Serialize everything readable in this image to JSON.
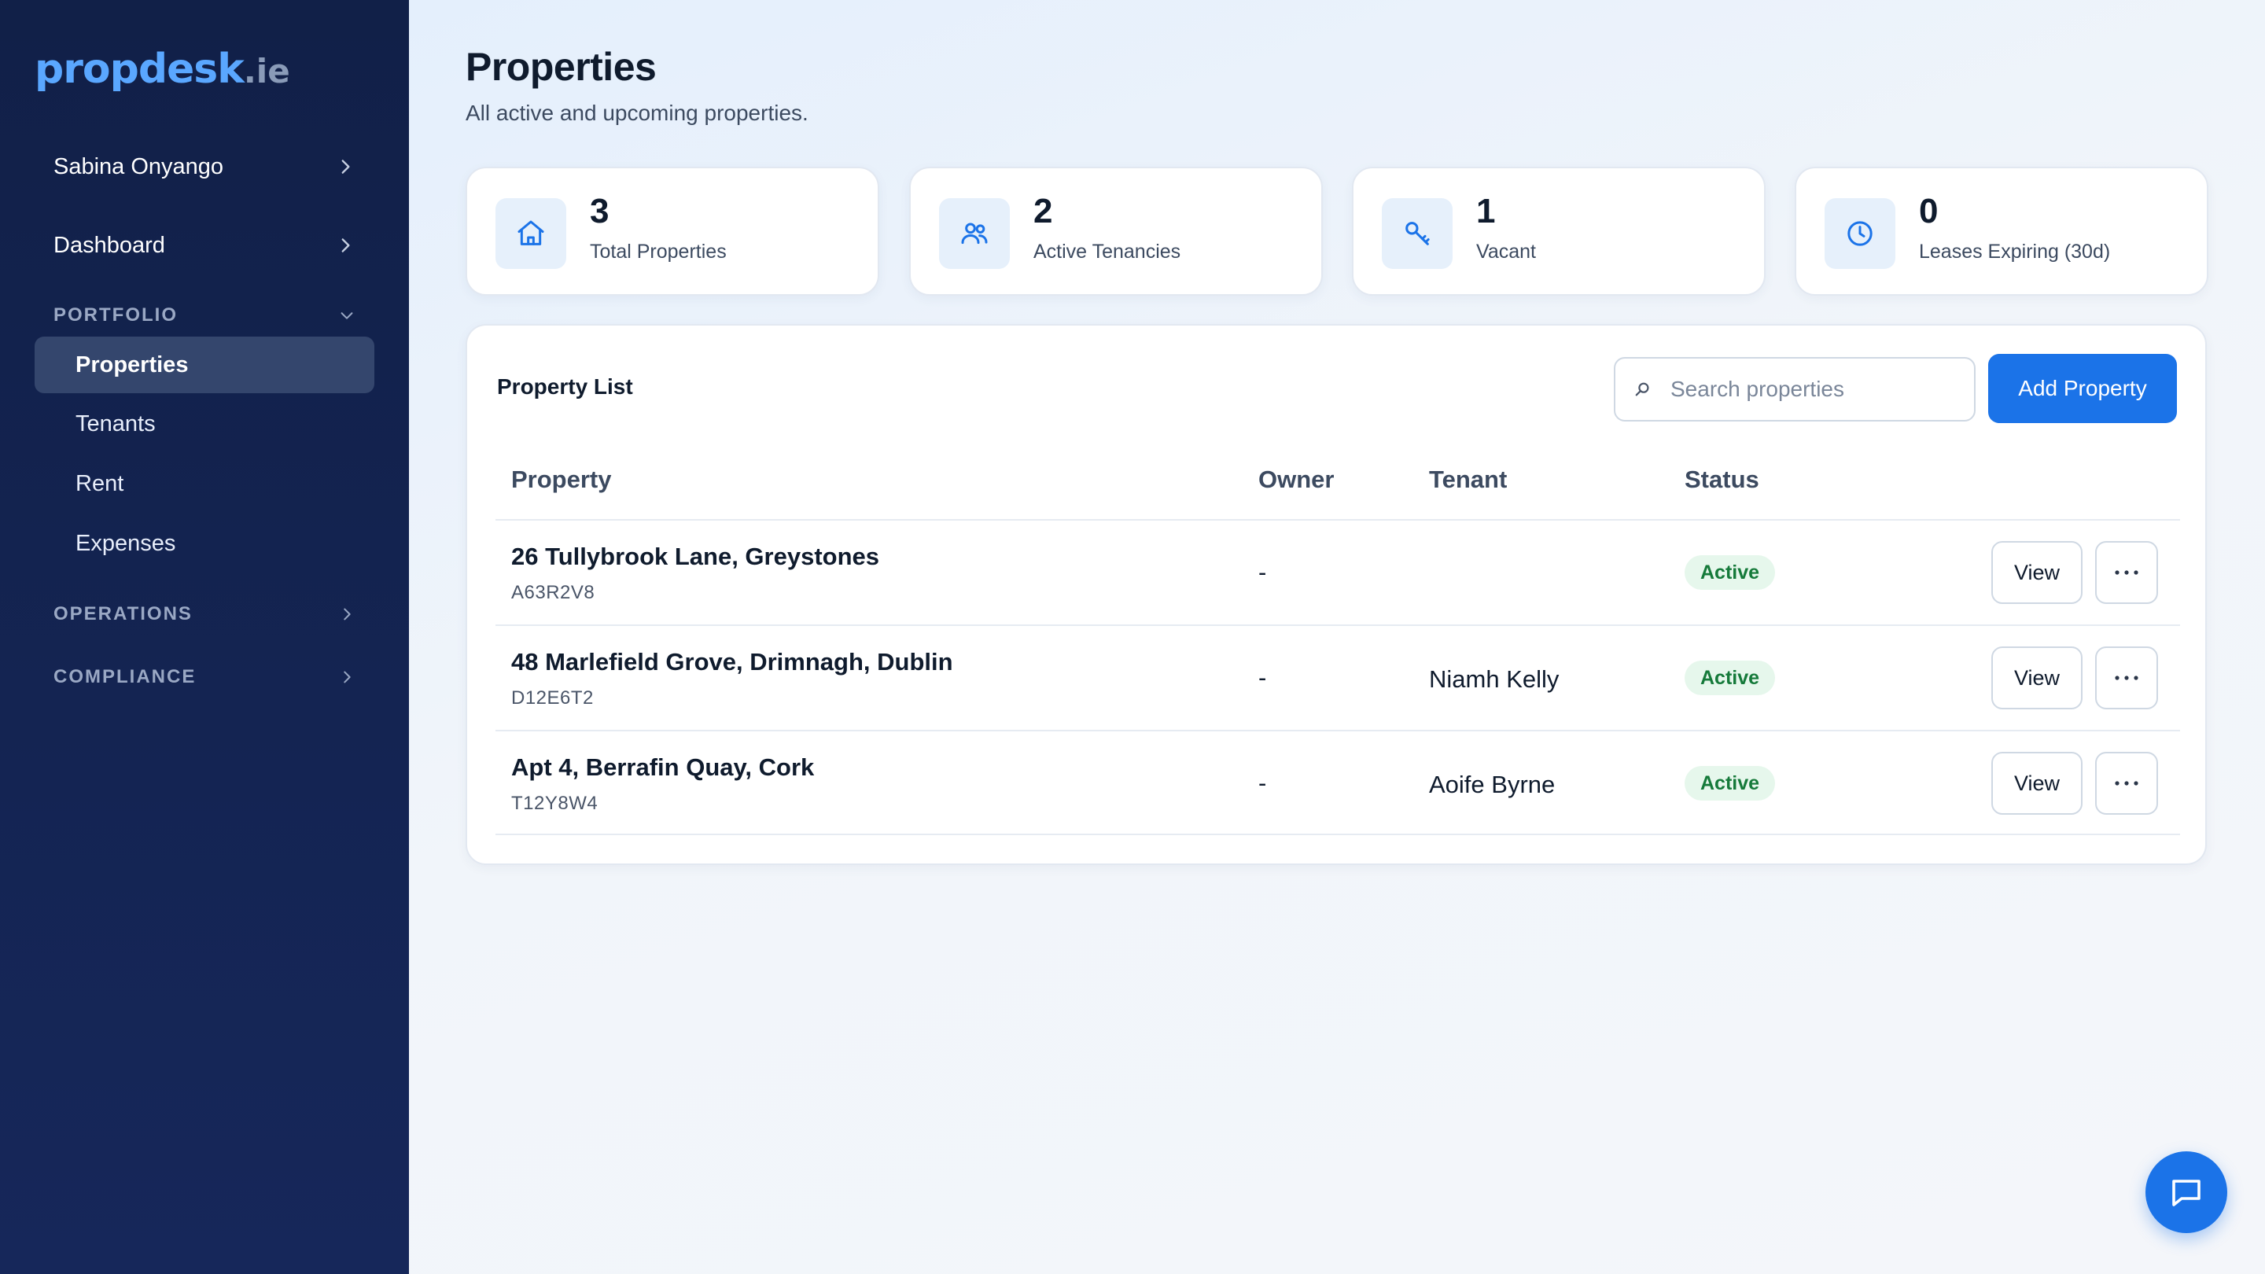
{
  "brand": {
    "name": "propdesk",
    "tld": ".ie",
    "color": "#5aa7ff"
  },
  "sidebar": {
    "user": "Sabina Onyango",
    "dashboard": "Dashboard",
    "sections": [
      {
        "title": "PORTFOLIO",
        "expanded": true,
        "items": [
          {
            "label": "Properties",
            "active": true
          },
          {
            "label": "Tenants",
            "active": false
          },
          {
            "label": "Rent",
            "active": false
          },
          {
            "label": "Expenses",
            "active": false
          }
        ]
      },
      {
        "title": "OPERATIONS",
        "expanded": false,
        "items": []
      },
      {
        "title": "COMPLIANCE",
        "expanded": false,
        "items": []
      }
    ]
  },
  "page": {
    "title": "Properties",
    "subtitle": "All active and upcoming properties."
  },
  "stats": [
    {
      "value": "3",
      "label": "Total Properties",
      "icon": "home-icon"
    },
    {
      "value": "2",
      "label": "Active Tenancies",
      "icon": "users-icon"
    },
    {
      "value": "1",
      "label": "Vacant",
      "icon": "key-icon"
    },
    {
      "value": "0",
      "label": "Leases Expiring (30d)",
      "icon": "clock-icon"
    }
  ],
  "list": {
    "title": "Property List",
    "search_placeholder": "Search properties",
    "add_label": "Add Property",
    "columns": {
      "property": "Property",
      "owner": "Owner",
      "tenant": "Tenant",
      "status": "Status"
    },
    "rows": [
      {
        "name": "26 Tullybrook Lane, Greystones",
        "code": "A63R2V8",
        "owner": "-",
        "tenant": "",
        "status": "Active",
        "view": "View"
      },
      {
        "name": "48 Marlefield Grove, Drimnagh, Dublin",
        "code": "D12E6T2",
        "owner": "-",
        "tenant": "Niamh Kelly",
        "status": "Active",
        "view": "View"
      },
      {
        "name": "Apt 4, Berrafin Quay, Cork",
        "code": "T12Y8W4",
        "owner": "-",
        "tenant": "Aoife Byrne",
        "status": "Active",
        "view": "View"
      }
    ]
  },
  "colors": {
    "accent": "#1b73e8",
    "sidebar": "#112048",
    "active_badge_bg": "#e6f7ec",
    "active_badge_text": "#157a3a"
  }
}
